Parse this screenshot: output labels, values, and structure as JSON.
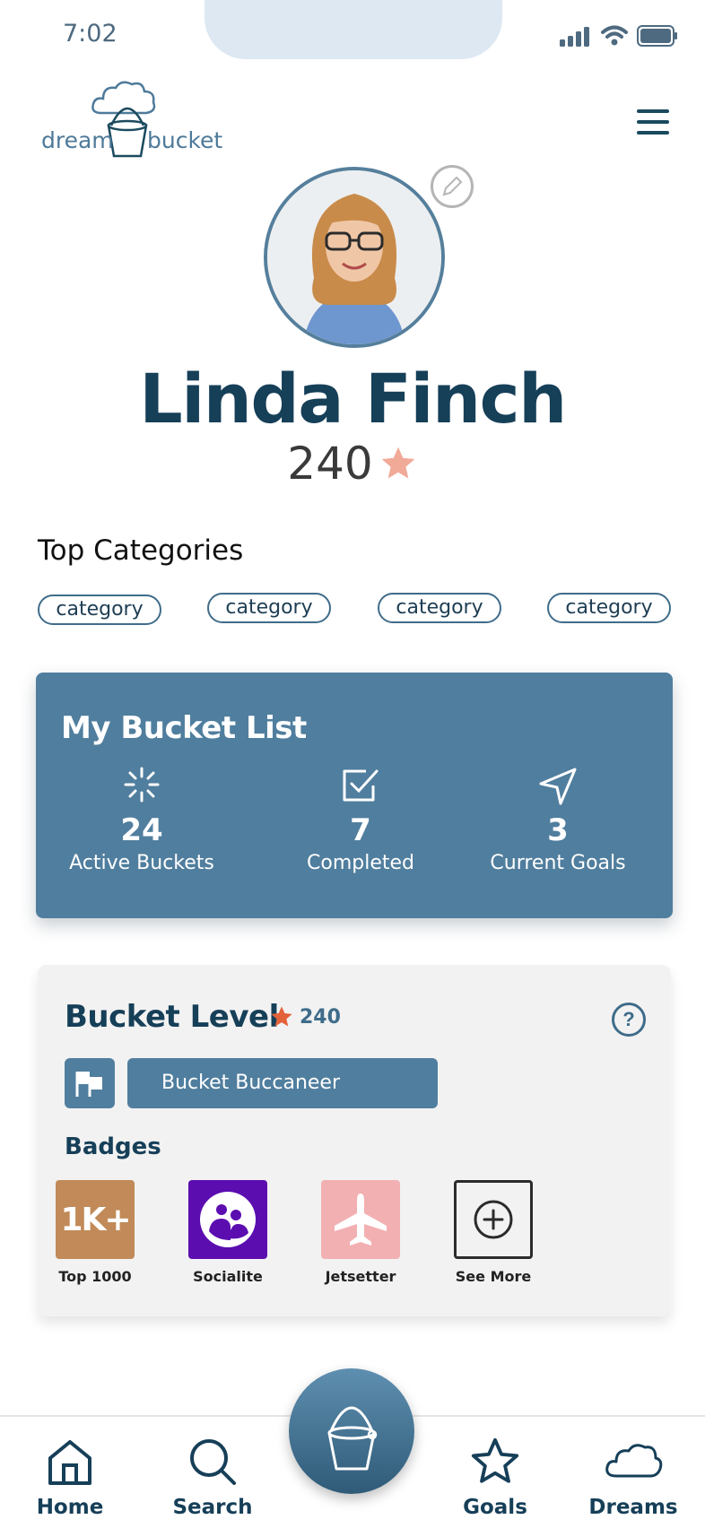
{
  "status_bar": {
    "time": "7:02"
  },
  "header": {
    "logo_word_left": "dream",
    "logo_word_right": "bucket",
    "menu_icon": "hamburger-menu-icon"
  },
  "profile": {
    "name": "Linda Finch",
    "points": "240",
    "edit_icon": "pencil-icon"
  },
  "top_categories": {
    "title": "Top Categories",
    "items": [
      "category",
      "category",
      "category",
      "category"
    ]
  },
  "bucket_list": {
    "title": "My Bucket List",
    "stats": [
      {
        "icon": "loading-spinner-icon",
        "value": "24",
        "label": "Active Buckets"
      },
      {
        "icon": "checkbox-icon",
        "value": "7",
        "label": "Completed"
      },
      {
        "icon": "navigation-arrow-icon",
        "value": "3",
        "label": "Current Goals"
      }
    ]
  },
  "bucket_level": {
    "title": "Bucket Level",
    "points": "240",
    "rank": "Bucket Buccaneer",
    "badges_title": "Badges",
    "badges": [
      {
        "name": "Top 1000",
        "tile_text": "1K+",
        "color": "#c18a58"
      },
      {
        "name": "Socialite",
        "icon": "group-icon",
        "color": "#5b0db0"
      },
      {
        "name": "Jetsetter",
        "icon": "airplane-icon",
        "color": "#f2b0b2"
      },
      {
        "name": "See More",
        "icon": "plus-circle-icon",
        "color": "#f2f2f2"
      }
    ]
  },
  "bottom_nav": {
    "items": [
      {
        "label": "Home",
        "icon": "home-icon"
      },
      {
        "label": "Search",
        "icon": "search-icon"
      },
      {
        "label": "Goals",
        "icon": "star-icon"
      },
      {
        "label": "Dreams",
        "icon": "cloud-icon"
      }
    ],
    "center_icon": "bucket-icon"
  },
  "colors": {
    "brand_dark": "#163f58",
    "brand_blue": "#507e9e",
    "star_pink": "#f1a998",
    "star_orange": "#e2623a"
  }
}
